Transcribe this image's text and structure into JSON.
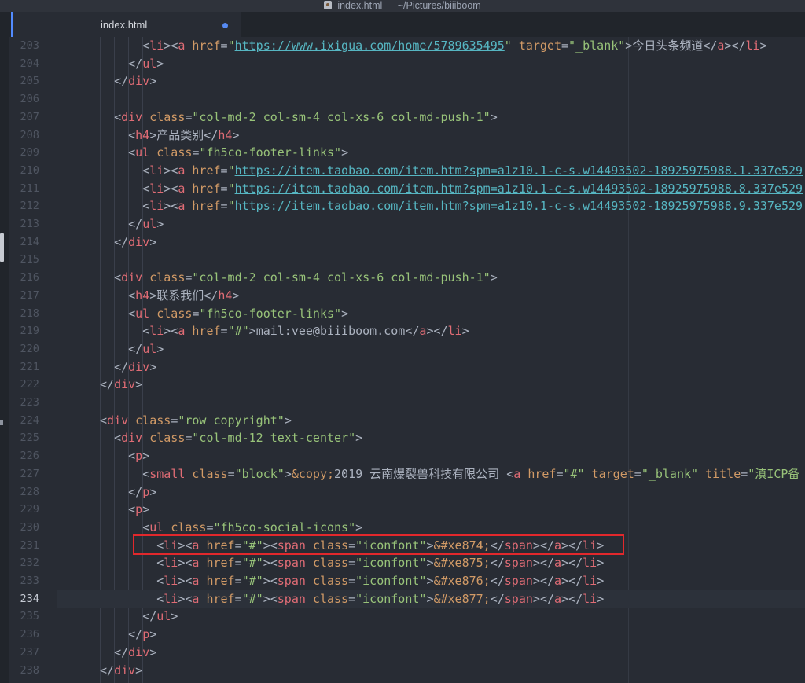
{
  "window": {
    "title": "index.html — ~/Pictures/biiiboom"
  },
  "tab": {
    "title": "index.html"
  },
  "editor": {
    "line_numbers": [
      "203",
      "204",
      "205",
      "206",
      "207",
      "208",
      "209",
      "210",
      "211",
      "212",
      "213",
      "214",
      "215",
      "216",
      "217",
      "218",
      "219",
      "220",
      "221",
      "222",
      "223",
      "224",
      "225",
      "226",
      "227",
      "228",
      "229",
      "230",
      "231",
      "232",
      "233",
      "234",
      "235",
      "236",
      "237",
      "238"
    ],
    "current_line": "234",
    "highlighted_line": "231",
    "lines": [
      "      <li><a href=\"https://www.ixigua.com/home/5789635495\" target=\"_blank\">今日头条频道</a></li>",
      "    </ul>",
      "  </div>",
      "",
      "  <div class=\"col-md-2 col-sm-4 col-xs-6 col-md-push-1\">",
      "    <h4>产品类别</h4>",
      "    <ul class=\"fh5co-footer-links\">",
      "      <li><a href=\"https://item.taobao.com/item.htm?spm=a1z10.1-c-s.w14493502-18925975988.1.337e529",
      "      <li><a href=\"https://item.taobao.com/item.htm?spm=a1z10.1-c-s.w14493502-18925975988.8.337e529",
      "      <li><a href=\"https://item.taobao.com/item.htm?spm=a1z10.1-c-s.w14493502-18925975988.9.337e529",
      "    </ul>",
      "  </div>",
      "",
      "  <div class=\"col-md-2 col-sm-4 col-xs-6 col-md-push-1\">",
      "    <h4>联系我们</h4>",
      "    <ul class=\"fh5co-footer-links\">",
      "      <li><a href=\"#\">mail:vee@biiiboom.com</a></li>",
      "    </ul>",
      "  </div>",
      "</div>",
      "",
      "<div class=\"row copyright\">",
      "  <div class=\"col-md-12 text-center\">",
      "    <p>",
      "      <small class=\"block\">&copy;2019 云南爆裂兽科技有限公司 <a href=\"#\" target=\"_blank\" title=\"滇ICP备",
      "    </p>",
      "    <p>",
      "      <ul class=\"fh5co-social-icons\">",
      "        <li><a href=\"#\"><span class=\"iconfont\">&#xe874;</span></a></li>",
      "        <li><a href=\"#\"><span class=\"iconfont\">&#xe875;</span></a></li>",
      "        <li><a href=\"#\"><span class=\"iconfont\">&#xe876;</span></a></li>",
      "        <li><a href=\"#\"><span class=\"iconfont\">&#xe877;</span></a></li>",
      "      </ul>",
      "    </p>",
      "  </div>",
      "</div>"
    ]
  },
  "colors": {
    "background": "#282c34",
    "accent": "#528bff",
    "annotation_box": "#e2282c"
  }
}
